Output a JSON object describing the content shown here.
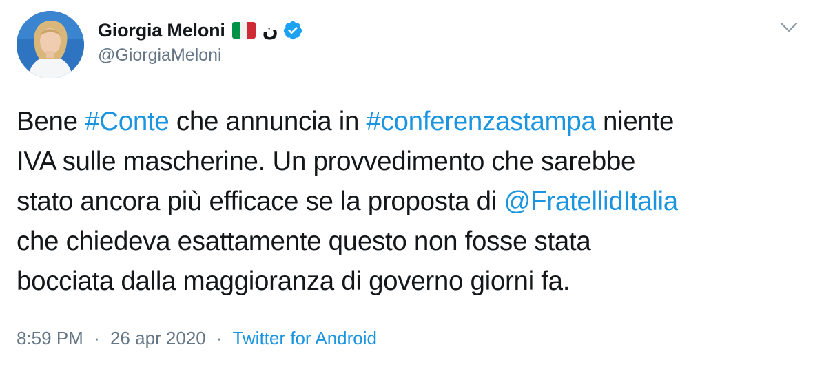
{
  "tweet": {
    "author": {
      "display_name": "Giorgia Meloni",
      "flag_icon": "italy-flag-icon",
      "extra_glyph": "ن",
      "verified_icon": "verified-badge-icon",
      "handle": "@GiorgiaMeloni"
    },
    "menu_icon": "chevron-down-icon",
    "text_lines": [
      [
        {
          "t": "Bene ",
          "link": false
        },
        {
          "t": "#Conte",
          "link": true
        },
        {
          "t": " che annuncia in ",
          "link": false
        },
        {
          "t": "#conferenzastampa",
          "link": true
        },
        {
          "t": " niente",
          "link": false
        }
      ],
      [
        {
          "t": "IVA sulle mascherine. Un provvedimento che sarebbe",
          "link": false
        }
      ],
      [
        {
          "t": "stato ancora più efficace se la proposta di ",
          "link": false
        },
        {
          "t": "@FratellidItalia",
          "link": true
        }
      ],
      [
        {
          "t": "che chiedeva esattamente questo non fosse stata",
          "link": false
        }
      ],
      [
        {
          "t": "bocciata dalla maggioranza di governo giorni fa.",
          "link": false
        }
      ]
    ],
    "time": "8:59 PM",
    "separator": "·",
    "date": "26 apr 2020",
    "source": "Twitter for Android"
  },
  "colors": {
    "link": "#1b95e0",
    "secondary_text": "#657786",
    "primary_text": "#14171a",
    "verified": "#1da1f2",
    "flag_green": "#009246",
    "flag_white": "#ffffff",
    "flag_red": "#ce2b37"
  }
}
